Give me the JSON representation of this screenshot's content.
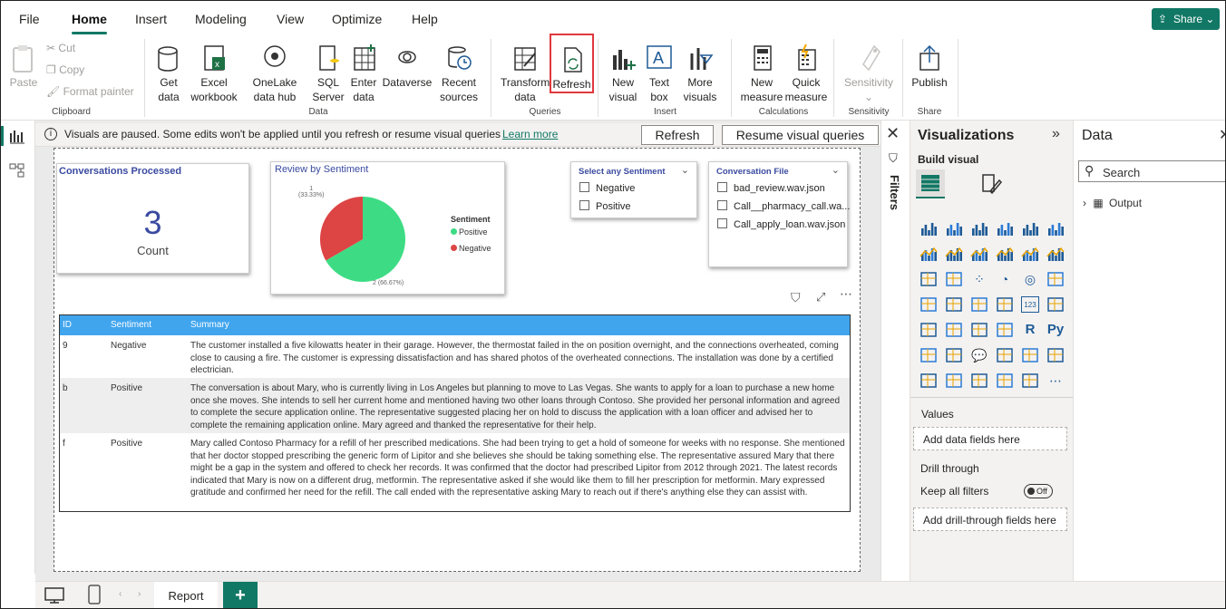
{
  "tabs": [
    "File",
    "Home",
    "Insert",
    "Modeling",
    "View",
    "Optimize",
    "Help"
  ],
  "share_label": "Share",
  "ribbon": {
    "clipboard": {
      "paste": "Paste",
      "cut": "Cut",
      "copy": "Copy",
      "format_painter": "Format painter",
      "group": "Clipboard"
    },
    "data": {
      "get_data": "Get data",
      "excel": "Excel workbook",
      "onelake": "OneLake data hub",
      "sql": "SQL Server",
      "enter": "Enter data",
      "dataverse": "Dataverse",
      "recent": "Recent sources",
      "group": "Data"
    },
    "queries": {
      "transform": "Transform data",
      "refresh": "Refresh",
      "group": "Queries"
    },
    "insert": {
      "new_visual": "New visual",
      "text_box": "Text box",
      "more_visuals": "More visuals",
      "group": "Insert"
    },
    "calculations": {
      "new_measure": "New measure",
      "quick_measure": "Quick measure",
      "group": "Calculations"
    },
    "sensitivity": {
      "label": "Sensitivity",
      "group": "Sensitivity"
    },
    "share": {
      "publish": "Publish",
      "group": "Share"
    }
  },
  "warning": {
    "text": "Visuals are paused. Some edits won't be applied until you refresh or resume visual queries",
    "learn_more": "Learn more",
    "refresh_btn": "Refresh",
    "resume_btn": "Resume visual queries"
  },
  "card": {
    "title": "Conversations Processed",
    "value": "3",
    "label": "Count"
  },
  "pie": {
    "title": "Review by Sentiment",
    "legend_title": "Sentiment",
    "legend": [
      "Positive",
      "Negative"
    ],
    "label_negative": "1\n(33.33%)",
    "label_positive": "2 (66.67%)",
    "colors": {
      "positive": "#3ddc84",
      "negative": "#dd4444"
    }
  },
  "chart_data": {
    "type": "pie",
    "title": "Review by Sentiment",
    "categories": [
      "Positive",
      "Negative"
    ],
    "values": [
      2,
      1
    ],
    "percent": [
      66.67,
      33.33
    ]
  },
  "slicer1": {
    "title": "Select any Sentiment",
    "items": [
      "Negative",
      "Positive"
    ]
  },
  "slicer2": {
    "title": "Conversation File",
    "items": [
      "bad_review.wav.json",
      "Call__pharmacy_call.wa...",
      "Call_apply_loan.wav.json"
    ]
  },
  "table": {
    "headers": [
      "ID",
      "Sentiment",
      "Summary"
    ],
    "rows": [
      {
        "id": "9",
        "sentiment": "Negative",
        "summary": "The customer installed a five kilowatts heater in their garage. However, the thermostat failed in the on position overnight, and the connections overheated, coming close to causing a fire. The customer is expressing dissatisfaction and has shared photos of the overheated connections. The installation was done by a certified electrician."
      },
      {
        "id": "b",
        "sentiment": "Positive",
        "summary": "The conversation is about Mary, who is currently living in Los Angeles but planning to move to Las Vegas. She wants to apply for a loan to purchase a new home once she moves. She intends to sell her current home and mentioned having two other loans through Contoso. She provided her personal information and agreed to complete the secure application online. The representative suggested placing her on hold to discuss the application with a loan officer and advised her to complete the remaining application online. Mary agreed and thanked the representative for their help."
      },
      {
        "id": "f",
        "sentiment": "Positive",
        "summary": "Mary called Contoso Pharmacy for a refill of her prescribed medications. She had been trying to get a hold of someone for weeks with no response. She mentioned that her doctor stopped prescribing the generic form of Lipitor and she believes she should be taking something else. The representative assured Mary that there might be a gap in the system and offered to check her records. It was confirmed that the doctor had prescribed Lipitor from 2012 through 2021. The latest records indicated that Mary is now on a different drug, metformin. The representative asked if she would like them to fill her prescription for metformin. Mary expressed gratitude and confirmed her need for the refill. The call ended with the representative asking Mary to reach out if there's anything else they can assist with."
      }
    ]
  },
  "filters_label": "Filters",
  "viz": {
    "title": "Visualizations",
    "build": "Build visual",
    "values": "Values",
    "add_fields": "Add data fields here",
    "drill": "Drill through",
    "keep_filters": "Keep all filters",
    "toggle": "Off",
    "add_drill": "Add drill-through fields here"
  },
  "data_pane": {
    "title": "Data",
    "search": "Search",
    "output": "Output"
  },
  "bottom": {
    "page_tab": "Report",
    "add": "+"
  }
}
